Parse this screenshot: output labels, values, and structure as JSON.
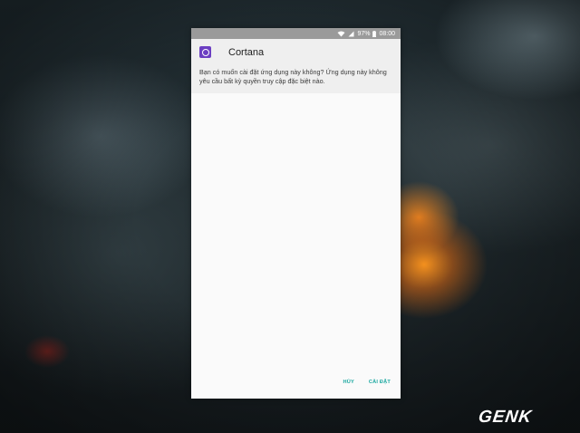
{
  "status_bar": {
    "battery": "97%",
    "time": "08:00"
  },
  "dialog": {
    "app_name": "Cortana",
    "message": "Bạn có muốn cài đặt ứng dụng này không? Ứng dụng này không yêu cầu bất kỳ quyền truy cập đặc biệt nào.",
    "app_icon": "cortana-icon",
    "cancel_label": "HỦY",
    "install_label": "CÀI ĐẶT"
  },
  "watermark": {
    "text": "GENK"
  },
  "colors": {
    "accent": "#1aa8a0",
    "app_icon_bg": "#6c3fc2",
    "status_bar_bg": "#9a9a9a"
  }
}
